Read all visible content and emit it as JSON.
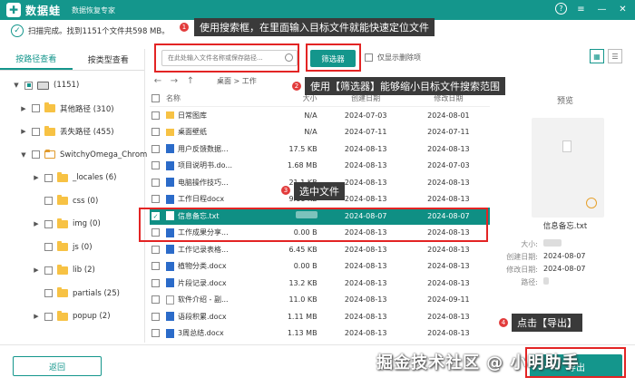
{
  "app": {
    "logo_glyph": "✚",
    "name": "数据蛙",
    "subtitle": "数据恢复专家"
  },
  "window_controls": {
    "help": "?",
    "menu": "≡",
    "minimize": "—",
    "close": "✕"
  },
  "scan": {
    "icon": "✓",
    "status": "扫描完成。找到1151个文件共598 MB。"
  },
  "left_tabs": [
    {
      "label": "按路径查看",
      "active": true
    },
    {
      "label": "按类型查看",
      "active": false
    }
  ],
  "tree": [
    {
      "label": "(1151)",
      "level": 0,
      "expander": "▼",
      "type": "drive",
      "check": "half"
    },
    {
      "label": "其他路径 (310)",
      "level": 1,
      "expander": "▶",
      "type": "folder",
      "check": "none"
    },
    {
      "label": "丢失路径 (455)",
      "level": 1,
      "expander": "▶",
      "type": "folder",
      "check": "none"
    },
    {
      "label": "SwitchyOmega_Chrom",
      "level": 1,
      "expander": "▼",
      "type": "folder-outline",
      "check": "none"
    },
    {
      "label": "_locales (6)",
      "level": 2,
      "expander": "▶",
      "type": "folder",
      "check": "none"
    },
    {
      "label": "css (0)",
      "level": 2,
      "expander": "",
      "type": "folder",
      "check": "none"
    },
    {
      "label": "img (0)",
      "level": 2,
      "expander": "▶",
      "type": "folder",
      "check": "none"
    },
    {
      "label": "js (0)",
      "level": 2,
      "expander": "",
      "type": "folder",
      "check": "none"
    },
    {
      "label": "lib (2)",
      "level": 2,
      "expander": "▶",
      "type": "folder",
      "check": "none"
    },
    {
      "label": "partials (25)",
      "level": 2,
      "expander": "",
      "type": "folder",
      "check": "none"
    },
    {
      "label": "popup (2)",
      "level": 2,
      "expander": "▶",
      "type": "folder",
      "check": "none"
    }
  ],
  "toolbar": {
    "search_placeholder": "在此处输入文件名称或保存路径...",
    "filter_label": "筛选器",
    "only_deleted_label": "仅显示删除项"
  },
  "nav": {
    "back": "←",
    "forward": "→",
    "up": "↑",
    "breadcrumb": "桌面 > 工作"
  },
  "table": {
    "headers": {
      "name": "名称",
      "size": "大小",
      "created": "创建日期",
      "modified": "修改日期"
    },
    "rows": [
      {
        "name": "日常图库",
        "icon": "folder",
        "size": "N/A",
        "created": "2024-07-03",
        "modified": "2024-08-01",
        "selected": false
      },
      {
        "name": "桌面壁纸",
        "icon": "folder",
        "size": "N/A",
        "created": "2024-07-11",
        "modified": "2024-07-11",
        "selected": false
      },
      {
        "name": "用户反馈数据...",
        "icon": "doc",
        "size": "17.5 KB",
        "created": "2024-08-13",
        "modified": "2024-08-13",
        "selected": false
      },
      {
        "name": "项目说明书.do...",
        "icon": "doc",
        "size": "1.68 MB",
        "created": "2024-08-13",
        "modified": "2024-07-03",
        "selected": false
      },
      {
        "name": "电脑操作技巧...",
        "icon": "doc",
        "size": "21.1 KB",
        "created": "2024-08-13",
        "modified": "2024-08-13",
        "selected": false
      },
      {
        "name": "工作日程docx",
        "icon": "doc",
        "size": "9.11 KB",
        "created": "2024-08-13",
        "modified": "2024-08-13",
        "selected": false
      },
      {
        "name": "信息备忘.txt",
        "icon": "txt",
        "size": "",
        "created": "2024-08-07",
        "modified": "2024-08-07",
        "selected": true
      },
      {
        "name": "工作成果分享...",
        "icon": "doc",
        "size": "0.00 B",
        "created": "2024-08-13",
        "modified": "2024-08-13",
        "selected": false
      },
      {
        "name": "工作记录表格...",
        "icon": "doc",
        "size": "6.45 KB",
        "created": "2024-08-13",
        "modified": "2024-08-13",
        "selected": false
      },
      {
        "name": "植物分类.docx",
        "icon": "doc",
        "size": "0.00 B",
        "created": "2024-08-13",
        "modified": "2024-08-13",
        "selected": false
      },
      {
        "name": "片段记录.docx",
        "icon": "doc",
        "size": "13.2 KB",
        "created": "2024-08-13",
        "modified": "2024-08-13",
        "selected": false
      },
      {
        "name": "软件介绍 - 副...",
        "icon": "txt",
        "size": "11.0 KB",
        "created": "2024-08-13",
        "modified": "2024-09-11",
        "selected": false
      },
      {
        "name": "语段积累.docx",
        "icon": "doc",
        "size": "1.11 MB",
        "created": "2024-08-13",
        "modified": "2024-08-13",
        "selected": false
      },
      {
        "name": "3周总结.docx",
        "icon": "doc",
        "size": "1.13 MB",
        "created": "2024-08-13",
        "modified": "2024-08-13",
        "selected": false
      }
    ]
  },
  "preview": {
    "title": "预览",
    "filename": "信息备忘.txt",
    "meta": [
      {
        "key": "大小:",
        "value": ""
      },
      {
        "key": "创建日期:",
        "value": "2024-08-07"
      },
      {
        "key": "修改日期:",
        "value": "2024-08-07"
      },
      {
        "key": "路径:",
        "value": ""
      }
    ]
  },
  "bottom": {
    "back_label": "返回",
    "export_label": "导出"
  },
  "watermark": "掘金技术社区 @ 小明助手",
  "annotations": [
    {
      "num": "1",
      "text": "使用搜索框，在里面输入目标文件就能快速定位文件"
    },
    {
      "num": "2",
      "text": "使用【筛选器】能够缩小目标文件搜索范围"
    },
    {
      "num": "3",
      "text": "选中文件"
    },
    {
      "num": "4",
      "text": "点击【导出】"
    }
  ],
  "colors": {
    "accent": "#14968c",
    "annotation_red": "#e32424",
    "callout_bg": "#3a3a3a"
  }
}
